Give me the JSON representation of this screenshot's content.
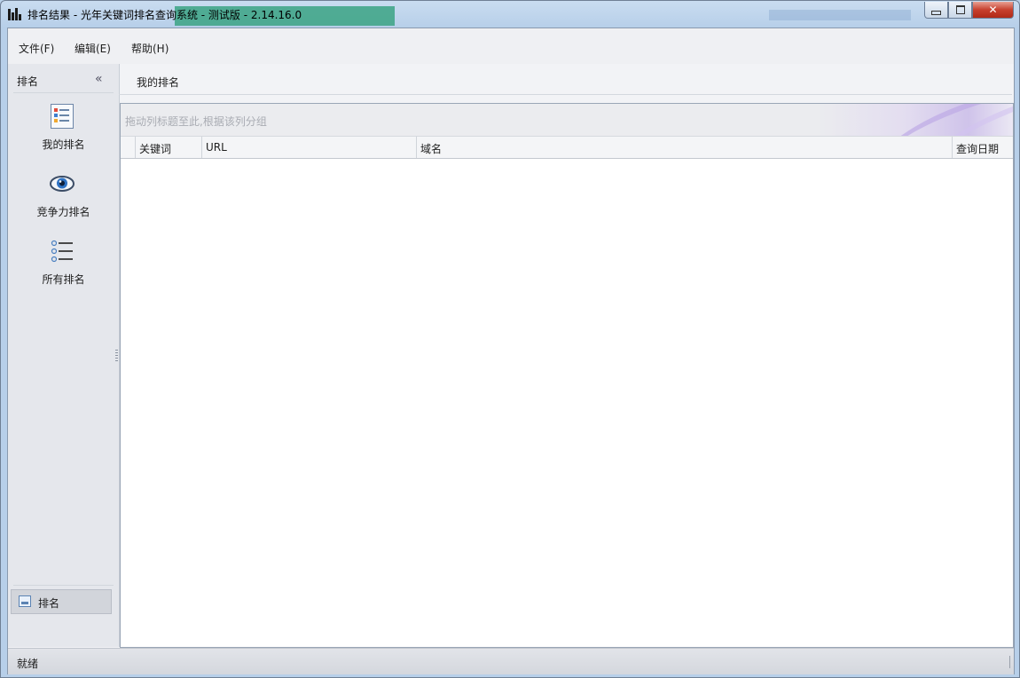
{
  "window": {
    "title": "排名结果 - 光年关键词排名查询系统 - 测试版 - 2.14.16.0",
    "controls": {
      "minimize": "▭",
      "maximize": "▢",
      "close": "✕"
    }
  },
  "menu": [
    {
      "label": "文件(F)"
    },
    {
      "label": "编辑(E)"
    },
    {
      "label": "帮助(H)"
    }
  ],
  "nav": {
    "header": "排名",
    "collapse_glyph": "«",
    "items": [
      {
        "label": "我的排名",
        "icon": "list-icon"
      },
      {
        "label": "竞争力排名",
        "icon": "eye-icon"
      },
      {
        "label": "所有排名",
        "icon": "bullet-list-icon"
      }
    ],
    "bottom_button": "排名"
  },
  "content": {
    "tab_title": "我的排名",
    "group_hint": "拖动列标题至此,根据该列分组",
    "columns": [
      "关键词",
      "URL",
      "域名",
      "查询日期"
    ],
    "rows": []
  },
  "status": {
    "text": "就绪"
  }
}
